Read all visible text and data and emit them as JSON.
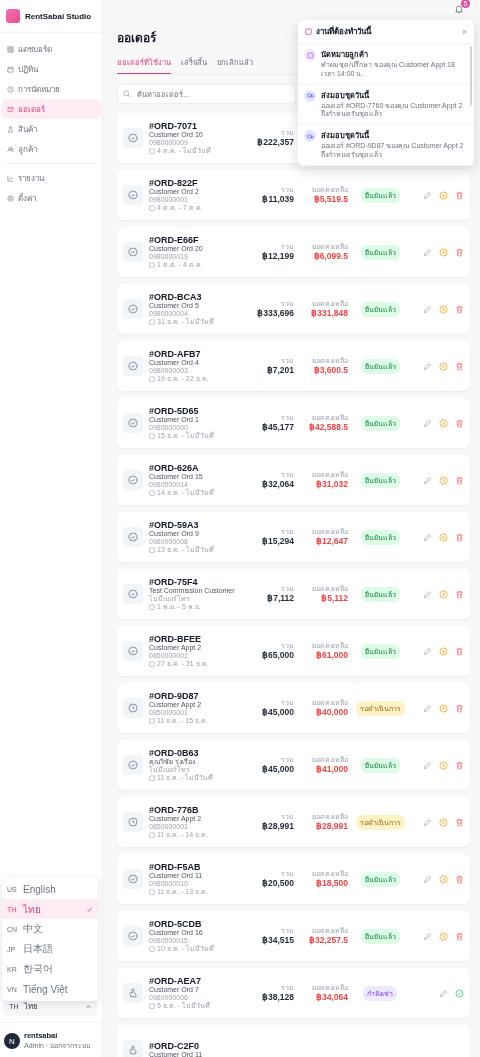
{
  "app": {
    "name": "RentSabai Studio"
  },
  "sidebar": {
    "items": [
      {
        "label": "แดชบอร์ด",
        "selected": false
      },
      {
        "label": "ปฏิทิน",
        "selected": false
      },
      {
        "label": "การนัดหมาย",
        "selected": false
      },
      {
        "label": "ออเดอร์",
        "selected": true
      },
      {
        "label": "สินค้า",
        "selected": false
      },
      {
        "label": "ลูกค้า",
        "selected": false
      },
      {
        "label": "รายงาน",
        "selected": false
      },
      {
        "label": "ตั้งค่า",
        "selected": false
      }
    ]
  },
  "language_menu": {
    "items": [
      {
        "code": "US",
        "label": "English",
        "selected": false
      },
      {
        "code": "TH",
        "label": "ไทย",
        "selected": true
      },
      {
        "code": "CN",
        "label": "中文",
        "selected": false
      },
      {
        "code": "JP",
        "label": "日本語",
        "selected": false
      },
      {
        "code": "KR",
        "label": "한국어",
        "selected": false
      },
      {
        "code": "VN",
        "label": "Tiếng Việt",
        "selected": false
      }
    ]
  },
  "language_selector": {
    "code": "TH",
    "label": "ไทย",
    "expanded": true
  },
  "user": {
    "initial": "N",
    "name": "rentsabai",
    "role": "Admin · ออกจากระบบ"
  },
  "notifications": {
    "count": "5"
  },
  "page": {
    "title": "ออเดอร์"
  },
  "tabs": [
    {
      "label": "ออเดอร์ที่ใช้งาน",
      "selected": true
    },
    {
      "label": "เสร็จสิ้น",
      "selected": false
    },
    {
      "label": "ยกเลิกแล้ว",
      "selected": false
    }
  ],
  "search": {
    "placeholder": "ค้นหาออเดอร์..."
  },
  "orders": [
    {
      "kind": "confirmed",
      "id": "#ORD-7071",
      "customer": "Customer Ord 10",
      "phone": "0980000009",
      "dates": "4 ต.ค. - ไม่มีวันที่",
      "total_label": "รวม",
      "total": "฿222,357"
    },
    {
      "kind": "confirmed",
      "id": "#ORD-822F",
      "customer": "Customer Ord 2",
      "phone": "0980000001",
      "dates": "4 ต.ค. - 7 ต.ค.",
      "total_label": "รวม",
      "total": "฿11,039",
      "remaining_label": "ยอดคงเหลือ",
      "remaining": "฿5,519.5",
      "status": "ยืนยันแล้ว"
    },
    {
      "kind": "confirmed",
      "id": "#ORD-E66F",
      "customer": "Customer Ord 20",
      "phone": "0980000019",
      "dates": "1 ต.ค. - 4 ต.ค.",
      "total_label": "รวม",
      "total": "฿12,199",
      "remaining_label": "ยอดคงเหลือ",
      "remaining": "฿6,099.5",
      "status": "ยืนยันแล้ว"
    },
    {
      "kind": "confirmed",
      "id": "#ORD-BCA3",
      "customer": "Customer Ord 5",
      "phone": "0980000004",
      "dates": "31 ธ.ค. - ไม่มีวันที่",
      "total_label": "รวม",
      "total": "฿333,696",
      "remaining_label": "ยอดคงเหลือ",
      "remaining": "฿331,848",
      "status": "ยืนยันแล้ว"
    },
    {
      "kind": "confirmed",
      "id": "#ORD-AFB7",
      "customer": "Customer Ord 4",
      "phone": "0980000003",
      "dates": "19 ธ.ค. - 22 ธ.ค.",
      "total_label": "รวม",
      "total": "฿7,201",
      "remaining_label": "ยอดคงเหลือ",
      "remaining": "฿3,600.5",
      "status": "ยืนยันแล้ว"
    },
    {
      "kind": "confirmed",
      "id": "#ORD-5D65",
      "customer": "Customer Ord 1",
      "phone": "0980000000",
      "dates": "15 ธ.ค. - ไม่มีวันที่",
      "total_label": "รวม",
      "total": "฿45,177",
      "remaining_label": "ยอดคงเหลือ",
      "remaining": "฿42,588.5",
      "status": "ยืนยันแล้ว"
    },
    {
      "kind": "confirmed",
      "id": "#ORD-626A",
      "customer": "Customer Ord 15",
      "phone": "0980000014",
      "dates": "14 ธ.ค. - ไม่มีวันที่",
      "total_label": "รวม",
      "total": "฿32,064",
      "remaining_label": "ยอดคงเหลือ",
      "remaining": "฿31,032",
      "status": "ยืนยันแล้ว"
    },
    {
      "kind": "confirmed",
      "id": "#ORD-59A3",
      "customer": "Customer Ord 9",
      "phone": "0980000008",
      "dates": "13 ธ.ค. - ไม่มีวันที่",
      "total_label": "รวม",
      "total": "฿15,294",
      "remaining_label": "ยอดคงเหลือ",
      "remaining": "฿12,647",
      "status": "ยืนยันแล้ว"
    },
    {
      "kind": "confirmed",
      "id": "#ORD-75F4",
      "customer": "Test Commission Customer",
      "phone": "ไม่มีเบอร์โทร",
      "dates": "1 พ.ย. - 5 พ.ย.",
      "total_label": "รวม",
      "total": "฿7,112",
      "remaining_label": "ยอดคงเหลือ",
      "remaining": "฿5,112",
      "status": "ยืนยันแล้ว"
    },
    {
      "kind": "confirmed",
      "id": "#ORD-BFEE",
      "customer": "Customer Appt 2",
      "phone": "0850000001",
      "dates": "27 ธ.ค. - 31 ธ.ค.",
      "total_label": "รวม",
      "total": "฿65,000",
      "remaining_label": "ยอดคงเหลือ",
      "remaining": "฿61,000",
      "status": "ยืนยันแล้ว"
    },
    {
      "kind": "pending",
      "id": "#ORD-9D87",
      "customer": "Customer Appt 2",
      "phone": "0850000001",
      "dates": "11 ธ.ค. - 15 ธ.ค.",
      "total_label": "รวม",
      "total": "฿45,000",
      "remaining_label": "ยอดคงเหลือ",
      "remaining": "฿40,000",
      "status": "รอดำเนินการ"
    },
    {
      "kind": "confirmed",
      "id": "#ORD-0B63",
      "customer": "คุณวิชัย รุ่งเรือง",
      "phone": "ไม่มีเบอร์โทร",
      "dates": "11 ธ.ค. - ไม่มีวันที่",
      "total_label": "รวม",
      "total": "฿45,000",
      "remaining_label": "ยอดคงเหลือ",
      "remaining": "฿41,000",
      "status": "ยืนยันแล้ว"
    },
    {
      "kind": "pending",
      "id": "#ORD-776B",
      "customer": "Customer Appt 2",
      "phone": "0850000001",
      "dates": "11 ธ.ค. - 14 ธ.ค.",
      "total_label": "รวม",
      "total": "฿28,991",
      "remaining_label": "ยอดคงเหลือ",
      "remaining": "฿28,991",
      "status": "รอดำเนินการ"
    },
    {
      "kind": "confirmed",
      "id": "#ORD-F5AB",
      "customer": "Customer Ord 11",
      "phone": "0980000010",
      "dates": "11 ธ.ค. - 13 ธ.ค.",
      "total_label": "รวม",
      "total": "฿20,500",
      "remaining_label": "ยอดคงเหลือ",
      "remaining": "฿18,500",
      "status": "ยืนยันแล้ว"
    },
    {
      "kind": "confirmed",
      "id": "#ORD-5CDB",
      "customer": "Customer Ord 16",
      "phone": "0980000015",
      "dates": "10 ธ.ค. - ไม่มีวันที่",
      "total_label": "รวม",
      "total": "฿34,515",
      "remaining_label": "ยอดคงเหลือ",
      "remaining": "฿32,257.5",
      "status": "ยืนยันแล้ว"
    },
    {
      "kind": "renting",
      "id": "#ORD-AEA7",
      "customer": "Customer Ord 7",
      "phone": "0980000006",
      "dates": "5 ธ.ค. - ไม่มีวันที่",
      "total_label": "รวม",
      "total": "฿38,128",
      "remaining_label": "ยอดคงเหลือ",
      "remaining": "฿34,064",
      "status": "กำลังเช่า"
    },
    {
      "kind": "renting",
      "id": "#ORD-C2F0",
      "customer": "Customer Ord 11"
    }
  ],
  "today_panel": {
    "title": "งานที่ต้องทำวันนี้",
    "close": "×",
    "items": [
      {
        "kind": "appointment",
        "title": "นัดหมายลูกค้า",
        "text": "ทำผมชุด/ปรึกษา ของคุณ Customer Appt 18 เวลา 14:00 น."
      },
      {
        "kind": "delivery",
        "title": "ส่งมอบชุดวันนี้",
        "text": "ออเดอร์ #ORD-7760 ของคุณ Customer Appt 2 ถึงกำหนดรับชุดแล้ว"
      },
      {
        "kind": "delivery",
        "title": "ส่งมอบชุดวันนี้",
        "text": "ออเดอร์ #ORD-9D87 ของคุณ Customer Appt 2 ถึงกำหนดรับชุดแล้ว"
      }
    ]
  }
}
